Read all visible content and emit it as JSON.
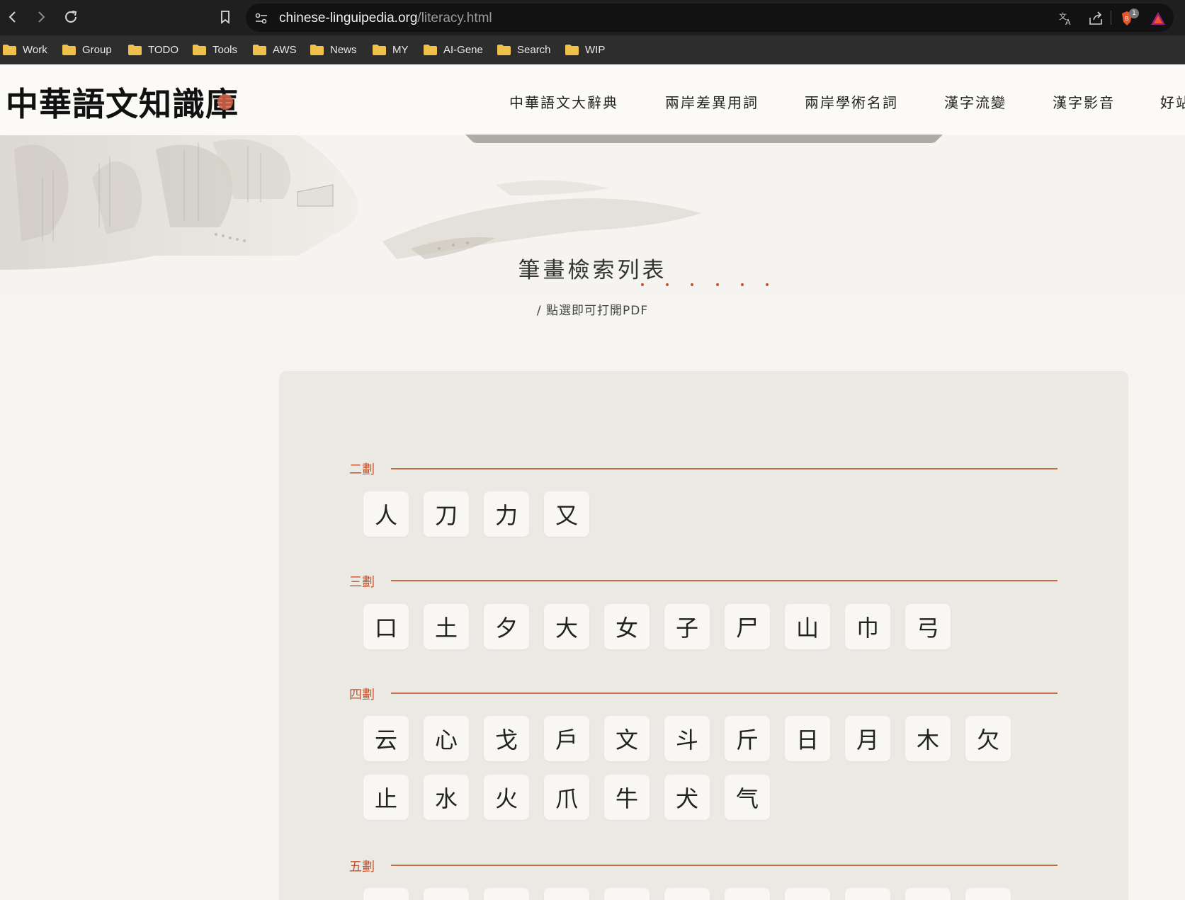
{
  "browser": {
    "url_domain": "chinese-linguipedia.org",
    "url_path": "/literacy.html",
    "icons": [
      "back-icon",
      "forward-icon",
      "reload-icon",
      "bookmark-icon",
      "site-settings-icon",
      "translate-icon",
      "share-icon",
      "brave-shield-icon",
      "brave-rewards-icon"
    ],
    "shield_count": "1",
    "bookmarks": [
      "Work",
      "Group",
      "TODO",
      "Tools",
      "AWS",
      "News",
      "MY",
      "AI-Gene",
      "Search",
      "WIP"
    ]
  },
  "site": {
    "logo_text": "中華語文知識庫",
    "nav": [
      "中華語文大辭典",
      "兩岸差異用詞",
      "兩岸學術名詞",
      "漢字流變",
      "漢字影音",
      "好站"
    ]
  },
  "page": {
    "title": "筆畫檢索列表",
    "subtitle": "/ 點選即可打開PDF"
  },
  "sections": [
    {
      "label": "二劃",
      "chars": [
        "人",
        "刀",
        "力",
        "又"
      ]
    },
    {
      "label": "三劃",
      "chars": [
        "口",
        "土",
        "夕",
        "大",
        "女",
        "子",
        "尸",
        "山",
        "巾",
        "弓"
      ]
    },
    {
      "label": "四劃",
      "chars": [
        "云",
        "心",
        "戈",
        "戶",
        "文",
        "斗",
        "斤",
        "日",
        "月",
        "木",
        "欠",
        "止",
        "水",
        "火",
        "爪",
        "牛",
        "犬",
        "气"
      ]
    },
    {
      "label": "五劃",
      "chars": []
    }
  ],
  "colors": {
    "accent": "#c2542d",
    "panel_bg": "#ebe9e4",
    "chrome_dark": "#1f1f1f"
  }
}
